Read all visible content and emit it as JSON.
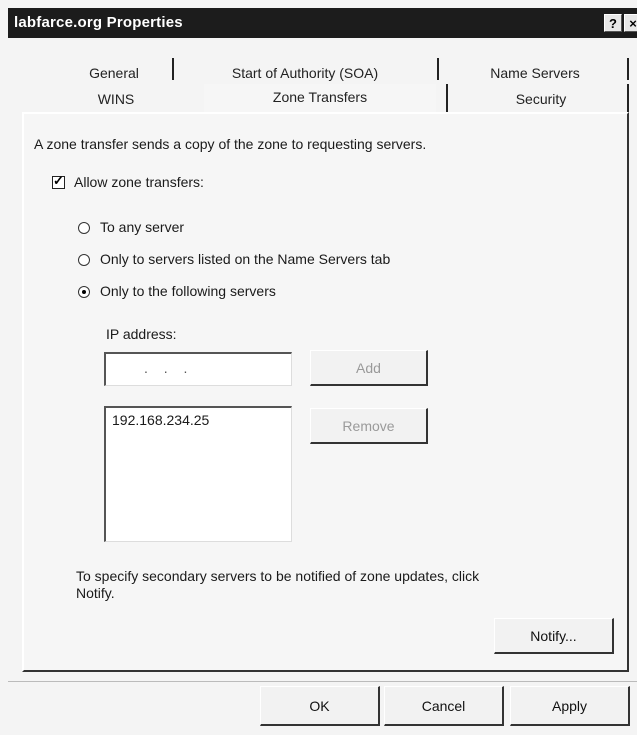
{
  "window": {
    "title": "labfarce.org Properties",
    "help_glyph": "?",
    "close_glyph": "×"
  },
  "tabs": {
    "row_back": [
      "General",
      "Start of Authority (SOA)",
      "Name Servers"
    ],
    "row_front": [
      "WINS",
      "Zone Transfers",
      "Security"
    ],
    "active": "Zone Transfers"
  },
  "zone_transfers": {
    "description": "A zone transfer sends a copy of the zone to requesting servers.",
    "allow_checkbox": {
      "label": "Allow zone transfers:",
      "checked": true
    },
    "options": [
      {
        "label": "To any server",
        "selected": false
      },
      {
        "label": "Only to servers listed on the Name Servers tab",
        "selected": false
      },
      {
        "label": "Only to the following servers",
        "selected": true
      }
    ],
    "ip_label": "IP address:",
    "ip_input_value": ".   .   .",
    "add_button": "Add",
    "remove_button": "Remove",
    "server_list": [
      "192.168.234.25"
    ],
    "notify_text_line1": "To specify secondary servers to be notified of zone updates, click",
    "notify_text_line2": "Notify.",
    "notify_button": "Notify..."
  },
  "footer": {
    "ok": "OK",
    "cancel": "Cancel",
    "apply": "Apply"
  }
}
